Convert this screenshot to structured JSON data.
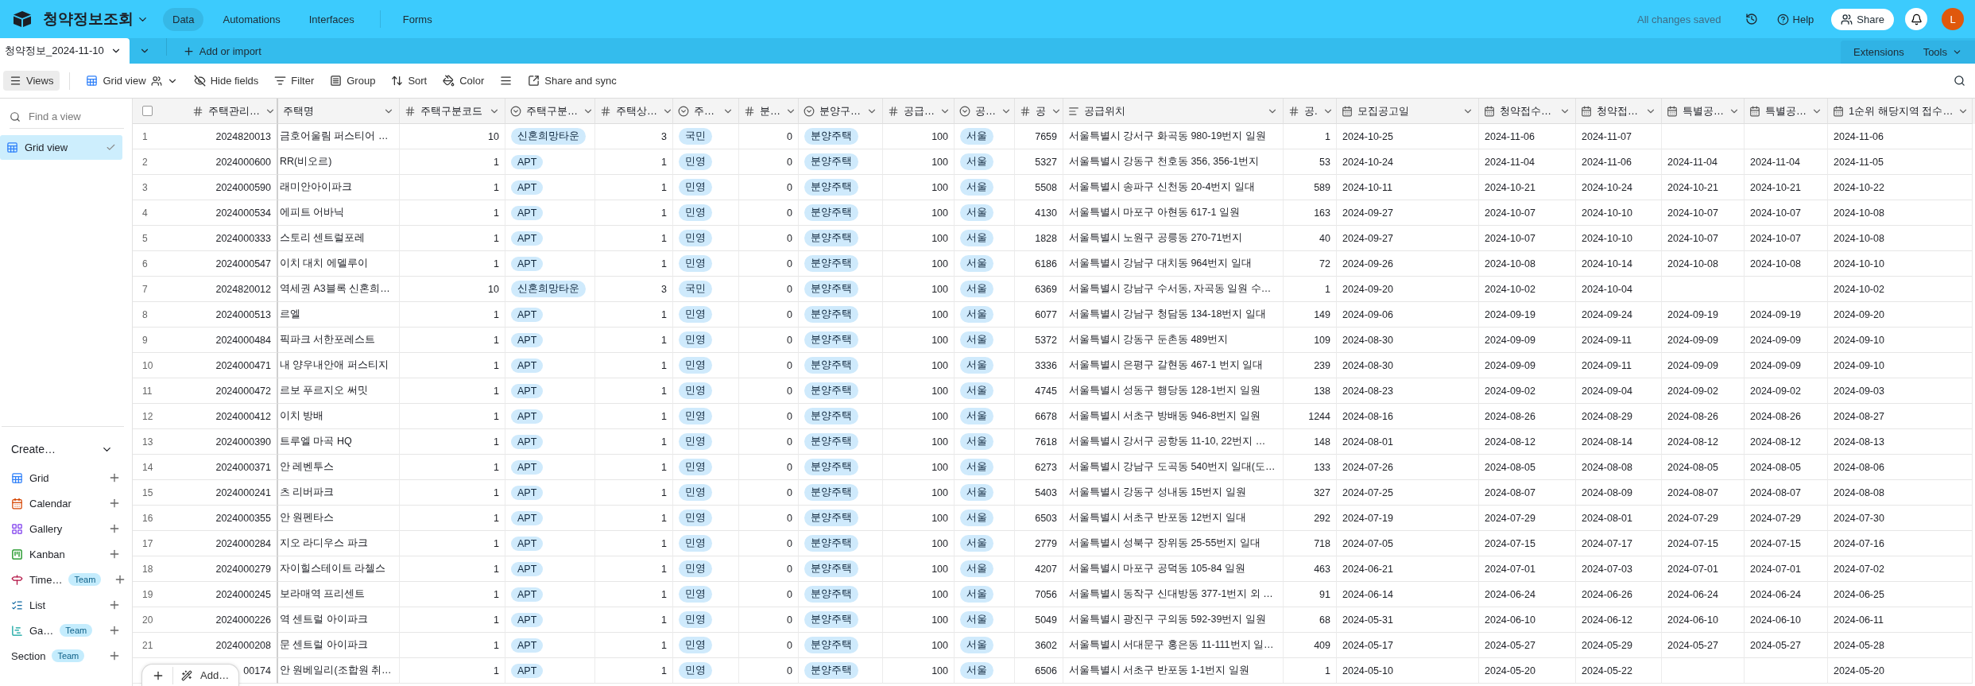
{
  "app": {
    "name": "청약정보조회",
    "nav": [
      {
        "label": "Data",
        "selected": true
      },
      {
        "label": "Automations",
        "selected": false
      },
      {
        "label": "Interfaces",
        "selected": false
      },
      {
        "label": "Forms",
        "selected": false
      }
    ],
    "status": "All changes saved",
    "help": "Help",
    "share": "Share",
    "avatar": "L"
  },
  "table_tabs": {
    "tabs": [
      {
        "label": "청약정보_2024-11-10",
        "selected": true
      }
    ],
    "add": "Add or import",
    "extensions": "Extensions",
    "tools": "Tools"
  },
  "toolbar": {
    "items": [
      {
        "kind": "views",
        "label": "Views",
        "active": true
      },
      {
        "kind": "view",
        "label": "Grid view",
        "active": false
      },
      {
        "kind": "hide",
        "label": "Hide fields",
        "active": false
      },
      {
        "kind": "filter",
        "label": "Filter",
        "active": false
      },
      {
        "kind": "group",
        "label": "Group",
        "active": false
      },
      {
        "kind": "sort",
        "label": "Sort",
        "active": false
      },
      {
        "kind": "color",
        "label": "Color",
        "active": false
      },
      {
        "kind": "row_height",
        "active": false
      },
      {
        "kind": "share",
        "label": "Share and sync",
        "active": false
      }
    ]
  },
  "sidebar": {
    "search": {
      "placeholder": "Find a view"
    },
    "views": [
      {
        "label": "Grid view",
        "selected": true
      }
    ],
    "create": {
      "label": "Create…",
      "items": [
        {
          "label": "Grid",
          "kind": "grid"
        },
        {
          "label": "Calendar",
          "kind": "calendar"
        },
        {
          "label": "Gallery",
          "kind": "gallery"
        },
        {
          "label": "Kanban",
          "kind": "kanban"
        },
        {
          "label": "Time…",
          "kind": "timeline",
          "badge": "Team"
        },
        {
          "label": "List",
          "kind": "list"
        },
        {
          "label": "Ga…",
          "kind": "gantt",
          "badge": "Team"
        },
        {
          "label": "Section",
          "kind": "section",
          "badge": "Team"
        }
      ]
    }
  },
  "table": {
    "select_all": {
      "checked": false
    },
    "columns": [
      {
        "label": "주택관리…",
        "kind": "number"
      },
      {
        "label": "주택명",
        "kind": "text",
        "clipped": true
      },
      {
        "label": "주택구분코드",
        "kind": "number"
      },
      {
        "label": "주택구분…",
        "kind": "select"
      },
      {
        "label": "주택상…",
        "kind": "number"
      },
      {
        "label": "주…",
        "kind": "select"
      },
      {
        "label": "분…",
        "kind": "number"
      },
      {
        "label": "분양구…",
        "kind": "select"
      },
      {
        "label": "공급…",
        "kind": "number"
      },
      {
        "label": "공…",
        "kind": "select"
      },
      {
        "label": "공",
        "kind": "number"
      },
      {
        "label": "공급위치",
        "kind": "longtext"
      },
      {
        "label": "공.",
        "kind": "number"
      },
      {
        "label": "모집공고일",
        "kind": "date"
      },
      {
        "label": "청약접수…",
        "kind": "date"
      },
      {
        "label": "청약접…",
        "kind": "date"
      },
      {
        "label": "특별공…",
        "kind": "date"
      },
      {
        "label": "특별공…",
        "kind": "date"
      },
      {
        "label": "1순위 해당지역 접수…",
        "kind": "date"
      }
    ],
    "rows": [
      {
        "number": "1",
        "cells": [
          "2024820013",
          "금호어울림 퍼스티어 …",
          "10",
          "신혼희망타운",
          "3",
          "국민",
          "0",
          "분양주택",
          "100",
          "서울",
          "7659",
          "서울특별시 강서구 화곡동 980-19번지 일원",
          "1",
          "2024-10-25",
          "2024-11-06",
          "2024-11-07",
          null,
          null,
          "2024-11-06"
        ]
      },
      {
        "number": "2",
        "cells": [
          "2024000600",
          "RR(비오르)",
          "1",
          "APT",
          "1",
          "민영",
          "0",
          "분양주택",
          "100",
          "서울",
          "5327",
          "서울특별시 강동구 천호동 356, 356-1번지",
          "53",
          "2024-10-24",
          "2024-11-04",
          "2024-11-06",
          "2024-11-04",
          "2024-11-04",
          "2024-11-05"
        ]
      },
      {
        "number": "3",
        "cells": [
          "2024000590",
          "래미안아이파크",
          "1",
          "APT",
          "1",
          "민영",
          "0",
          "분양주택",
          "100",
          "서울",
          "5508",
          "서울특별시 송파구 신천동 20-4번지 일대",
          "589",
          "2024-10-11",
          "2024-10-21",
          "2024-10-24",
          "2024-10-21",
          "2024-10-21",
          "2024-10-22"
        ]
      },
      {
        "number": "4",
        "cells": [
          "2024000534",
          "에피트 어바닉",
          "1",
          "APT",
          "1",
          "민영",
          "0",
          "분양주택",
          "100",
          "서울",
          "4130",
          "서울특별시 마포구 아현동 617-1 일원",
          "163",
          "2024-09-27",
          "2024-10-07",
          "2024-10-10",
          "2024-10-07",
          "2024-10-07",
          "2024-10-08"
        ]
      },
      {
        "number": "5",
        "cells": [
          "2024000333",
          "스토리 센트럴포레",
          "1",
          "APT",
          "1",
          "민영",
          "0",
          "분양주택",
          "100",
          "서울",
          "1828",
          "서울특별시 노원구 공릉동 270-71번지",
          "40",
          "2024-09-27",
          "2024-10-07",
          "2024-10-10",
          "2024-10-07",
          "2024-10-07",
          "2024-10-08"
        ]
      },
      {
        "number": "6",
        "cells": [
          "2024000547",
          "이치 대치 에델루이",
          "1",
          "APT",
          "1",
          "민영",
          "0",
          "분양주택",
          "100",
          "서울",
          "6186",
          "서울특별시 강남구 대치동 964번지 일대",
          "72",
          "2024-09-26",
          "2024-10-08",
          "2024-10-14",
          "2024-10-08",
          "2024-10-08",
          "2024-10-10"
        ]
      },
      {
        "number": "7",
        "cells": [
          "2024820012",
          "역세권 A3블록 신혼희…",
          "10",
          "신혼희망타운",
          "3",
          "국민",
          "0",
          "분양주택",
          "100",
          "서울",
          "6369",
          "서울특별시 강남구 수서동, 자곡동 일원 수…",
          "1",
          "2024-09-20",
          "2024-10-02",
          "2024-10-04",
          null,
          null,
          "2024-10-02"
        ]
      },
      {
        "number": "8",
        "cells": [
          "2024000513",
          "르엘",
          "1",
          "APT",
          "1",
          "민영",
          "0",
          "분양주택",
          "100",
          "서울",
          "6077",
          "서울특별시 강남구 청담동 134-18번지 일대",
          "149",
          "2024-09-06",
          "2024-09-19",
          "2024-09-24",
          "2024-09-19",
          "2024-09-19",
          "2024-09-20"
        ]
      },
      {
        "number": "9",
        "cells": [
          "2024000484",
          "픽파크 서한포레스트",
          "1",
          "APT",
          "1",
          "민영",
          "0",
          "분양주택",
          "100",
          "서울",
          "5372",
          "서울특별시 강동구 둔촌동 489번지",
          "109",
          "2024-08-30",
          "2024-09-09",
          "2024-09-11",
          "2024-09-09",
          "2024-09-09",
          "2024-09-10"
        ]
      },
      {
        "number": "10",
        "cells": [
          "2024000471",
          "내 양우내안애 퍼스티지",
          "1",
          "APT",
          "1",
          "민영",
          "0",
          "분양주택",
          "100",
          "서울",
          "3336",
          "서울특별시 은평구 갈현동 467-1 번지 일대",
          "239",
          "2024-08-30",
          "2024-09-09",
          "2024-09-11",
          "2024-09-09",
          "2024-09-09",
          "2024-09-10"
        ]
      },
      {
        "number": "11",
        "cells": [
          "2024000472",
          "르보 푸르지오 써밋",
          "1",
          "APT",
          "1",
          "민영",
          "0",
          "분양주택",
          "100",
          "서울",
          "4745",
          "서울특별시 성동구 행당동 128-1번지 일원",
          "138",
          "2024-08-23",
          "2024-09-02",
          "2024-09-04",
          "2024-09-02",
          "2024-09-02",
          "2024-09-03"
        ]
      },
      {
        "number": "12",
        "cells": [
          "2024000412",
          "이치 방배",
          "1",
          "APT",
          "1",
          "민영",
          "0",
          "분양주택",
          "100",
          "서울",
          "6678",
          "서울특별시 서초구 방배동 946-8번지 일원",
          "1244",
          "2024-08-16",
          "2024-08-26",
          "2024-08-29",
          "2024-08-26",
          "2024-08-26",
          "2024-08-27"
        ]
      },
      {
        "number": "13",
        "cells": [
          "2024000390",
          "트루엘 마곡 HQ",
          "1",
          "APT",
          "1",
          "민영",
          "0",
          "분양주택",
          "100",
          "서울",
          "7618",
          "서울특별시 강서구 공항동 11-10, 22번지 …",
          "148",
          "2024-08-01",
          "2024-08-12",
          "2024-08-14",
          "2024-08-12",
          "2024-08-12",
          "2024-08-13"
        ]
      },
      {
        "number": "14",
        "cells": [
          "2024000371",
          "안 레벤투스",
          "1",
          "APT",
          "1",
          "민영",
          "0",
          "분양주택",
          "100",
          "서울",
          "6273",
          "서울특별시 강남구 도곡동 540번지 일대(도…",
          "133",
          "2024-07-26",
          "2024-08-05",
          "2024-08-08",
          "2024-08-05",
          "2024-08-05",
          "2024-08-06"
        ]
      },
      {
        "number": "15",
        "cells": [
          "2024000241",
          "츠 리버파크",
          "1",
          "APT",
          "1",
          "민영",
          "0",
          "분양주택",
          "100",
          "서울",
          "5403",
          "서울특별시 강동구 성내동 15번지 일원",
          "327",
          "2024-07-25",
          "2024-08-07",
          "2024-08-09",
          "2024-08-07",
          "2024-08-07",
          "2024-08-08"
        ]
      },
      {
        "number": "16",
        "cells": [
          "2024000355",
          "안 원펜타스",
          "1",
          "APT",
          "1",
          "민영",
          "0",
          "분양주택",
          "100",
          "서울",
          "6503",
          "서울특별시 서초구 반포동 12번지 일대",
          "292",
          "2024-07-19",
          "2024-07-29",
          "2024-08-01",
          "2024-07-29",
          "2024-07-29",
          "2024-07-30"
        ]
      },
      {
        "number": "17",
        "cells": [
          "2024000284",
          "지오 라디우스 파크",
          "1",
          "APT",
          "1",
          "민영",
          "0",
          "분양주택",
          "100",
          "서울",
          "2779",
          "서울특별시 성북구 장위동 25-55번지 일대",
          "718",
          "2024-07-05",
          "2024-07-15",
          "2024-07-17",
          "2024-07-15",
          "2024-07-15",
          "2024-07-16"
        ]
      },
      {
        "number": "18",
        "cells": [
          "2024000279",
          "자이힐스테이트 라첼스",
          "1",
          "APT",
          "1",
          "민영",
          "0",
          "분양주택",
          "100",
          "서울",
          "4207",
          "서울특별시 마포구 공덕동 105-84 일원",
          "463",
          "2024-06-21",
          "2024-07-01",
          "2024-07-03",
          "2024-07-01",
          "2024-07-01",
          "2024-07-02"
        ]
      },
      {
        "number": "19",
        "cells": [
          "2024000245",
          "보라매역 프리센트",
          "1",
          "APT",
          "1",
          "민영",
          "0",
          "분양주택",
          "100",
          "서울",
          "7056",
          "서울특별시 동작구 신대방동 377-1번지 외 …",
          "91",
          "2024-06-14",
          "2024-06-24",
          "2024-06-26",
          "2024-06-24",
          "2024-06-24",
          "2024-06-25"
        ]
      },
      {
        "number": "20",
        "cells": [
          "2024000226",
          "역 센트럴 아이파크",
          "1",
          "APT",
          "1",
          "민영",
          "0",
          "분양주택",
          "100",
          "서울",
          "5049",
          "서울특별시 광진구 구의동 592-39번지 일원",
          "68",
          "2024-05-31",
          "2024-06-10",
          "2024-06-12",
          "2024-06-10",
          "2024-06-10",
          "2024-06-11"
        ]
      },
      {
        "number": "21",
        "cells": [
          "2024000208",
          "문 센트럴 아이파크",
          "1",
          "APT",
          "1",
          "민영",
          "0",
          "분양주택",
          "100",
          "서울",
          "3602",
          "서울특별시 서대문구 홍은동 11-111번지 일…",
          "409",
          "2024-05-17",
          "2024-05-27",
          "2024-05-29",
          "2024-05-27",
          "2024-05-27",
          "2024-05-28"
        ]
      },
      {
        "cells": [
          "00174",
          "안 원베일리(조합원 취…",
          "1",
          "APT",
          "1",
          "민영",
          "0",
          "분양주택",
          "100",
          "서울",
          "6506",
          "서울특별시 서초구 반포동 1-1번지 일원",
          "1",
          "2024-05-10",
          "2024-05-20",
          "2024-05-22",
          null,
          null,
          "2024-05-20"
        ]
      }
    ],
    "add_button": "Add…"
  }
}
